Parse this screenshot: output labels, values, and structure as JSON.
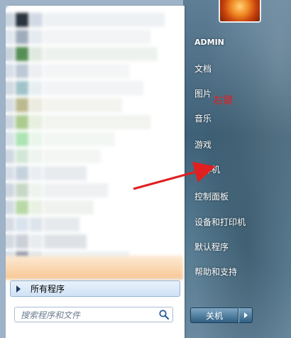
{
  "start_menu": {
    "user_name": "ADMIN",
    "right_items": [
      {
        "label": "文档"
      },
      {
        "label": "图片"
      },
      {
        "label": "音乐"
      },
      {
        "label": "游戏"
      },
      {
        "label": "计算机"
      },
      {
        "label": "控制面板"
      },
      {
        "label": "设备和打印机"
      },
      {
        "label": "默认程序"
      },
      {
        "label": "帮助和支持"
      }
    ],
    "all_programs_label": "所有程序",
    "search_placeholder": "搜索程序和文件",
    "shutdown_label": "关机",
    "annotation_text": "右键"
  },
  "colors": {
    "annotation": "#e02020",
    "arrow": "#e02020",
    "selected_program_bar": "#f7c48c"
  },
  "icons": [
    "search-icon",
    "right-arrow-icon",
    "shutdown-options-icon",
    "user-avatar-icon"
  ]
}
